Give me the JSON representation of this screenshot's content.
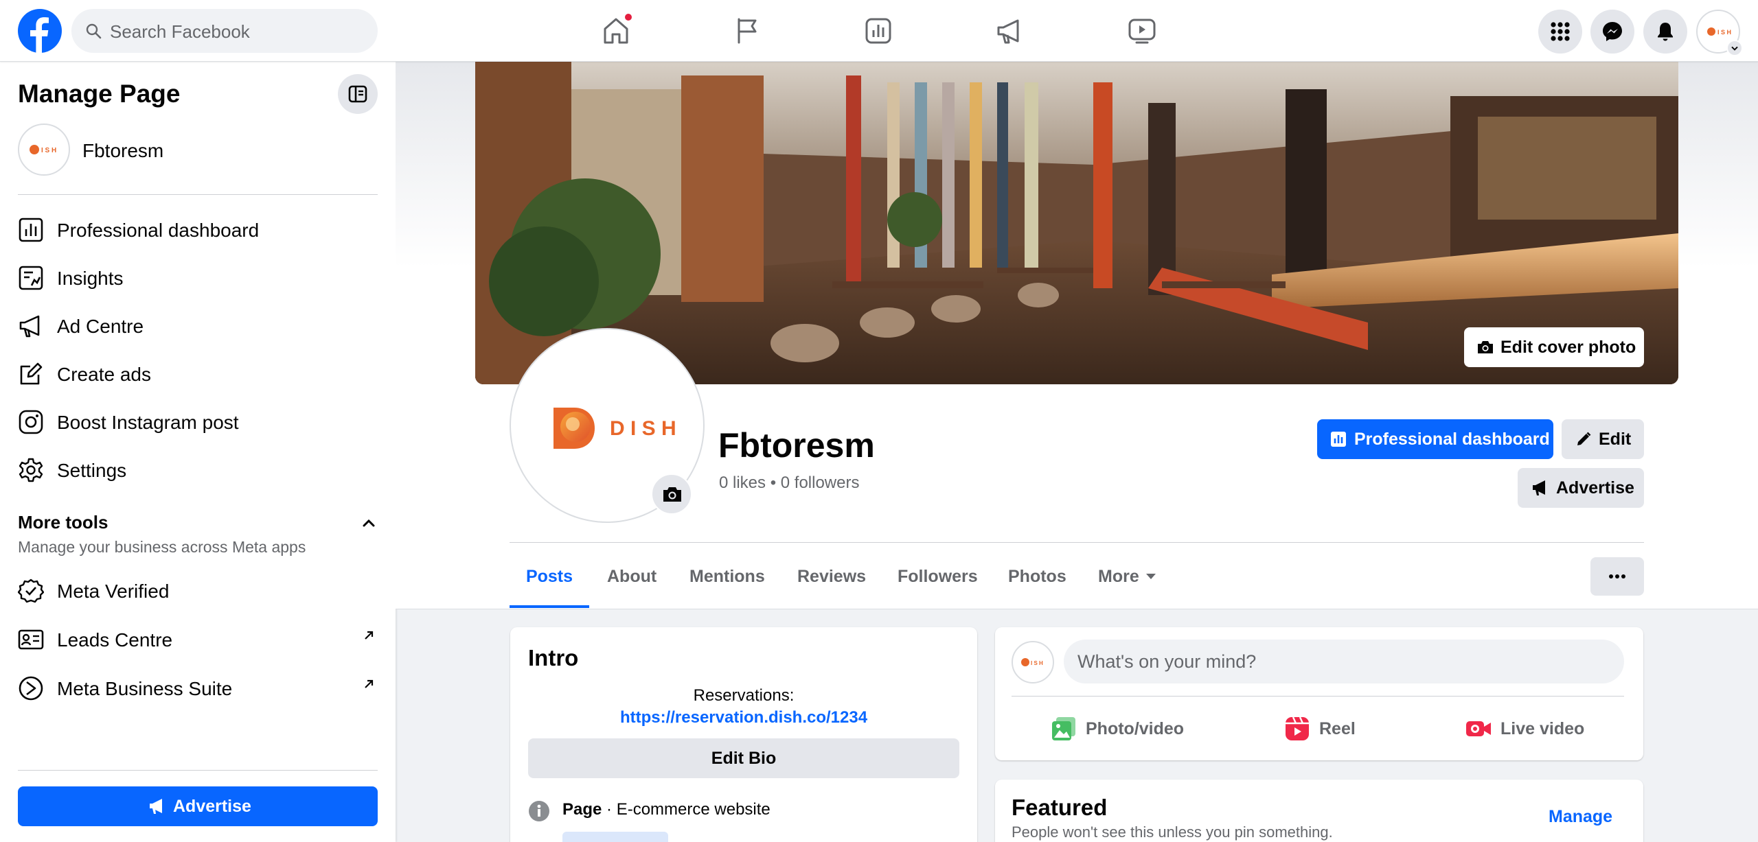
{
  "topbar": {
    "search_placeholder": "Search Facebook"
  },
  "left_panel": {
    "title": "Manage Page",
    "page_name": "Fbtoresm",
    "items": [
      {
        "label": "Professional dashboard",
        "icon": "dashboard-icon"
      },
      {
        "label": "Insights",
        "icon": "insights-icon"
      },
      {
        "label": "Ad Centre",
        "icon": "megaphone-icon"
      },
      {
        "label": "Create ads",
        "icon": "edit-icon"
      },
      {
        "label": "Boost Instagram post",
        "icon": "instagram-icon"
      },
      {
        "label": "Settings",
        "icon": "gear-icon"
      }
    ],
    "more_tools_title": "More tools",
    "more_tools_subtitle": "Manage your business across Meta apps",
    "tools": [
      {
        "label": "Meta Verified",
        "icon": "verified-badge-icon"
      },
      {
        "label": "Leads Centre",
        "icon": "id-card-icon"
      },
      {
        "label": "Meta Business Suite",
        "icon": "business-suite-icon"
      }
    ],
    "advertise_label": "Advertise"
  },
  "profile": {
    "edit_cover_label": "Edit cover photo",
    "logo_letters": "D I S H",
    "name": "Fbtoresm",
    "stats": "0 likes • 0 followers",
    "pro_dashboard_label": "Professional dashboard",
    "edit_label": "Edit",
    "advertise_label": "Advertise"
  },
  "tabs": [
    {
      "label": "Posts",
      "active": true
    },
    {
      "label": "About"
    },
    {
      "label": "Mentions"
    },
    {
      "label": "Reviews"
    },
    {
      "label": "Followers"
    },
    {
      "label": "Photos"
    },
    {
      "label": "More"
    }
  ],
  "intro": {
    "title": "Intro",
    "reservations_label": "Reservations:",
    "reservations_link": "https://reservation.dish.co/1234",
    "edit_bio_label": "Edit Bio",
    "category_prefix": "Page",
    "category": " · E-commerce website"
  },
  "composer": {
    "placeholder": "What's on your mind?",
    "actions": [
      {
        "label": "Photo/video",
        "icon": "photo-icon"
      },
      {
        "label": "Reel",
        "icon": "reel-icon"
      },
      {
        "label": "Live video",
        "icon": "live-video-icon"
      }
    ]
  },
  "featured": {
    "title": "Featured",
    "subtitle": "People won't see this unless you pin something.",
    "manage_label": "Manage"
  },
  "colors": {
    "brand_blue": "#0866ff",
    "notification_red": "#e41e3f",
    "dish_orange": "#e8672a"
  }
}
